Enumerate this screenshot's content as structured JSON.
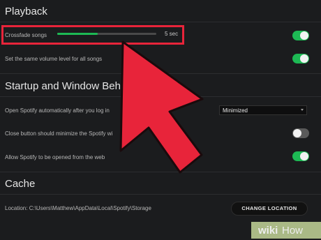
{
  "sections": {
    "playback": "Playback",
    "startup": "Startup and Window Beha",
    "cache": "Cache"
  },
  "playback": {
    "crossfade_label": "Crossfade songs",
    "crossfade_value": "5 sec",
    "crossfade_fill_fraction": 0.41,
    "crossfade_enabled": true,
    "normalize_label": "Set the same volume level for all songs",
    "normalize_enabled": true
  },
  "startup": {
    "open_auto_label": "Open Spotify automatically after you log in",
    "open_auto_value": "Minimized",
    "close_minimize_label": "Close button should minimize the Spotify wi",
    "close_minimize_enabled": false,
    "allow_web_label": "Allow Spotify to be opened from the web",
    "allow_web_enabled": true
  },
  "cache": {
    "location_label": "Location: C:\\Users\\Matthew\\AppData\\Local\\Spotify\\Storage",
    "change_location_button": "CHANGE LOCATION"
  },
  "overlay": {
    "highlight_color": "#e8243a",
    "arrow_color": "#e8243a"
  },
  "watermark": {
    "wiki": "wiki",
    "how": "How"
  },
  "colors": {
    "background": "#1b1c1e",
    "accent": "#1db954"
  }
}
